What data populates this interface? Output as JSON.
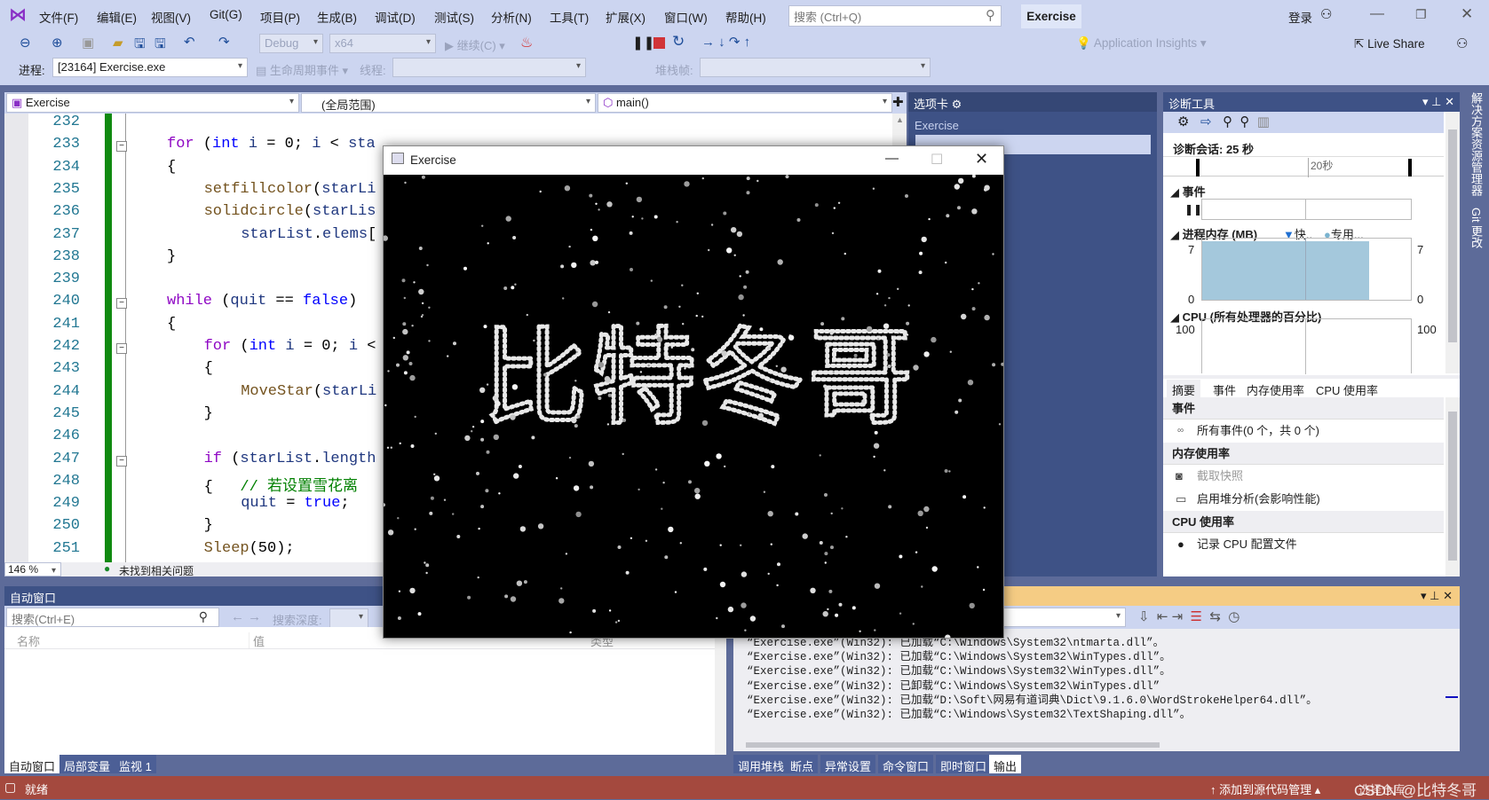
{
  "menu": [
    "文件(F)",
    "编辑(E)",
    "视图(V)",
    "Git(G)",
    "项目(P)",
    "生成(B)",
    "调试(D)",
    "测试(S)",
    "分析(N)",
    "工具(T)",
    "扩展(X)",
    "窗口(W)",
    "帮助(H)"
  ],
  "search": {
    "placeholder": "搜索 (Ctrl+Q)"
  },
  "solution_name": "Exercise",
  "login": "登录",
  "live_share": "Live Share",
  "toolbar": {
    "config": "Debug",
    "platform": "x64",
    "continue": "继续(C)",
    "app_insights": "Application Insights"
  },
  "debugbar": {
    "process_label": "进程:",
    "process": "[23164] Exercise.exe",
    "lifecycle": "生命周期事件",
    "thread_label": "线程:",
    "stackframe_label": "堆栈帧:"
  },
  "editor": {
    "project": "Exercise",
    "scope": "(全局范围)",
    "member": "main()",
    "zoom": "146 %",
    "issues": "未找到相关问题",
    "lines": [
      {
        "n": "232",
        "indent": 0,
        "t": []
      },
      {
        "n": "233",
        "indent": 1,
        "t": [
          [
            "for",
            "kw"
          ],
          [
            " (",
            "pl"
          ],
          [
            "int",
            "ty"
          ],
          [
            " ",
            "pl"
          ],
          [
            "i",
            "id"
          ],
          [
            " = 0; ",
            "pl"
          ],
          [
            "i",
            "id"
          ],
          [
            " < ",
            "pl"
          ],
          [
            "sta",
            "id"
          ]
        ]
      },
      {
        "n": "234",
        "indent": 1,
        "t": [
          [
            "{",
            "pl"
          ]
        ]
      },
      {
        "n": "235",
        "indent": 2,
        "t": [
          [
            "setfillcolor",
            "fn"
          ],
          [
            "(",
            "pl"
          ],
          [
            "starLi",
            "id"
          ]
        ]
      },
      {
        "n": "236",
        "indent": 2,
        "t": [
          [
            "solidcircle",
            "fn"
          ],
          [
            "(",
            "pl"
          ],
          [
            "starLis",
            "id"
          ]
        ]
      },
      {
        "n": "237",
        "indent": 3,
        "t": [
          [
            "starList",
            "id"
          ],
          [
            ".",
            "pl"
          ],
          [
            "elems",
            "id"
          ],
          [
            "[",
            "pl"
          ]
        ]
      },
      {
        "n": "238",
        "indent": 1,
        "t": [
          [
            "}",
            "pl"
          ]
        ]
      },
      {
        "n": "239",
        "indent": 0,
        "t": []
      },
      {
        "n": "240",
        "indent": 1,
        "t": [
          [
            "while",
            "kw"
          ],
          [
            " (",
            "pl"
          ],
          [
            "quit",
            "id"
          ],
          [
            " == ",
            "pl"
          ],
          [
            "false",
            "ty"
          ],
          [
            ")",
            "pl"
          ]
        ]
      },
      {
        "n": "241",
        "indent": 1,
        "t": [
          [
            "{",
            "pl"
          ]
        ]
      },
      {
        "n": "242",
        "indent": 2,
        "t": [
          [
            "for",
            "kw"
          ],
          [
            " (",
            "pl"
          ],
          [
            "int",
            "ty"
          ],
          [
            " ",
            "pl"
          ],
          [
            "i",
            "id"
          ],
          [
            " = 0; ",
            "pl"
          ],
          [
            "i",
            "id"
          ],
          [
            " <",
            "pl"
          ]
        ]
      },
      {
        "n": "243",
        "indent": 2,
        "t": [
          [
            "{",
            "pl"
          ]
        ]
      },
      {
        "n": "244",
        "indent": 3,
        "t": [
          [
            "MoveStar",
            "fn"
          ],
          [
            "(",
            "pl"
          ],
          [
            "starLi",
            "id"
          ]
        ]
      },
      {
        "n": "245",
        "indent": 2,
        "t": [
          [
            "}",
            "pl"
          ]
        ]
      },
      {
        "n": "246",
        "indent": 0,
        "t": []
      },
      {
        "n": "247",
        "indent": 2,
        "t": [
          [
            "if",
            "kw"
          ],
          [
            " (",
            "pl"
          ],
          [
            "starList",
            "id"
          ],
          [
            ".",
            "pl"
          ],
          [
            "length",
            "id"
          ]
        ]
      },
      {
        "n": "248",
        "indent": 2,
        "t": [
          [
            "{   ",
            "pl"
          ],
          [
            "// 若设置雪花离",
            "cm"
          ]
        ]
      },
      {
        "n": "249",
        "indent": 3,
        "t": [
          [
            "quit",
            "id"
          ],
          [
            " = ",
            "pl"
          ],
          [
            "true",
            "ty"
          ],
          [
            ";",
            "pl"
          ]
        ]
      },
      {
        "n": "250",
        "indent": 2,
        "t": [
          [
            "}",
            "pl"
          ]
        ]
      },
      {
        "n": "251",
        "indent": 2,
        "t": [
          [
            "Sleep",
            "fn"
          ],
          [
            "(50);",
            "pl"
          ]
        ]
      }
    ]
  },
  "tabs_panel": {
    "title": "选项卡",
    "project": "Exercise"
  },
  "app_window": {
    "title": "Exercise",
    "canvas_text": "比特冬哥"
  },
  "diag": {
    "title": "诊断工具",
    "session": "诊断会话: 25 秒",
    "timeline_label": "20秒",
    "events": "事件",
    "memory": "进程内存 (MB)",
    "legend_snapshot": "快..",
    "legend_private": "专用...",
    "mem_max": "7",
    "mem_min": "0",
    "cpu": "CPU (所有处理器的百分比)",
    "cpu_max": "100",
    "cpu_min": "0",
    "memory_fill_mb": 7,
    "tabs": [
      "摘要",
      "事件",
      "内存使用率",
      "CPU 使用率"
    ],
    "summary": {
      "events_head": "事件",
      "all_events": "所有事件(0 个，共 0 个)",
      "mem_head": "内存使用率",
      "snapshot": "截取快照",
      "heap": "启用堆分析(会影响性能)",
      "cpu_head": "CPU 使用率",
      "record_cpu": "记录 CPU 配置文件"
    }
  },
  "side_tabs": [
    "解决方案资源管理器",
    "Git 更改"
  ],
  "autos": {
    "title": "自动窗口",
    "search_placeholder": "搜索(Ctrl+E)",
    "depth_label": "搜索深度:",
    "cols": [
      "名称",
      "值",
      "类型"
    ],
    "tabs": [
      "自动窗口",
      "局部变量",
      "监视 1"
    ]
  },
  "output": {
    "lines": [
      "“Exercise.exe”(Win32): 已加载“C:\\Windows\\System32\\ntmarta.dll”。",
      "“Exercise.exe”(Win32): 已加载“C:\\Windows\\System32\\WinTypes.dll”。",
      "“Exercise.exe”(Win32): 已加载“C:\\Windows\\System32\\WinTypes.dll”。",
      "“Exercise.exe”(Win32): 已卸载“C:\\Windows\\System32\\WinTypes.dll”",
      "“Exercise.exe”(Win32): 已加载“D:\\Soft\\网易有道词典\\Dict\\9.1.6.0\\WordStrokeHelper64.dll”。",
      "“Exercise.exe”(Win32): 已加载“C:\\Windows\\System32\\TextShaping.dll”。"
    ],
    "tabs": [
      "调用堆栈",
      "断点",
      "异常设置",
      "命令窗口",
      "即时窗口",
      "输出"
    ]
  },
  "status": {
    "ready": "就绪",
    "source_control": "添加到源代码管理",
    "select_repo": "选择仓库",
    "watermark": "CSDN @比特冬哥"
  },
  "colors": {
    "statusbar": "#a4493e",
    "chrome": "#ccd5f0",
    "panel_header": "#3e5286",
    "output_header": "#f5cc84"
  }
}
